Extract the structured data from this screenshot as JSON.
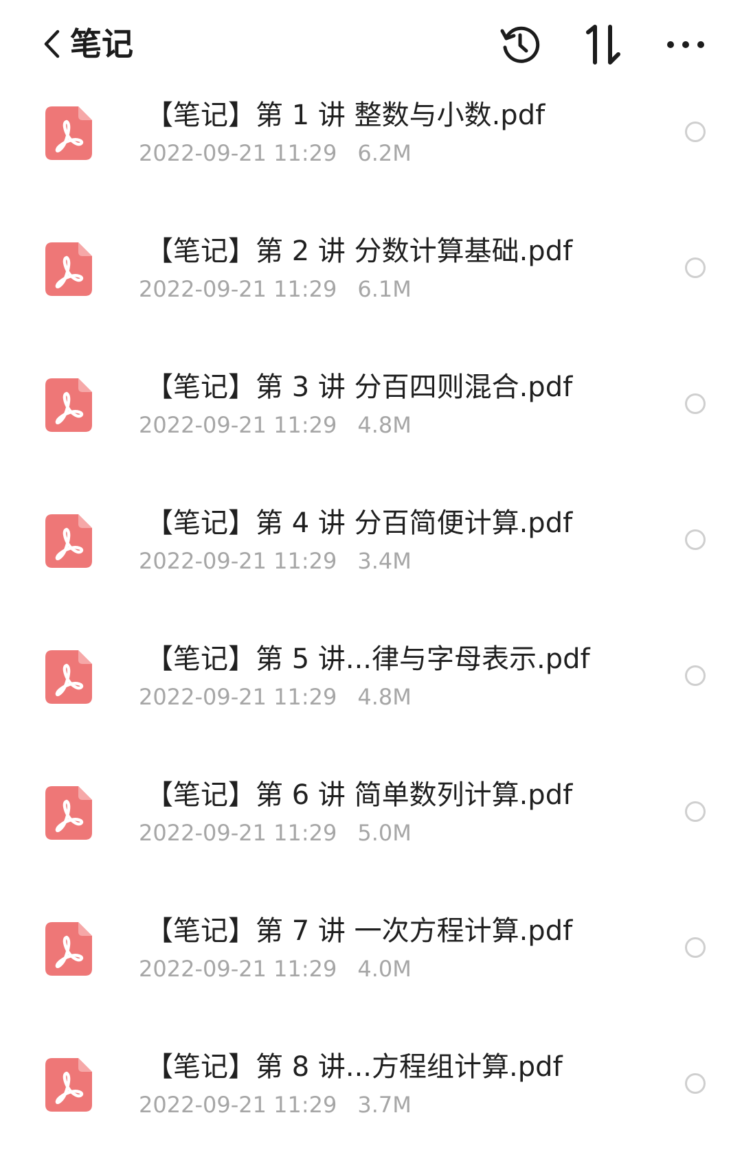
{
  "header": {
    "title": "笔记",
    "icons": {
      "back": "chevron-left-icon",
      "history": "history-icon",
      "sort": "sort-icon",
      "more": "more-horizontal-icon"
    }
  },
  "colors": {
    "pdf_icon": "#EE7777",
    "meta_text": "#A6A6A6",
    "radio_border": "#CFCFCF"
  },
  "files": [
    {
      "name": "【笔记】第 1 讲 整数与小数.pdf",
      "date": "2022-09-21 11:29",
      "size": "6.2M"
    },
    {
      "name": "【笔记】第 2 讲 分数计算基础.pdf",
      "date": "2022-09-21 11:29",
      "size": "6.1M"
    },
    {
      "name": "【笔记】第 3 讲 分百四则混合.pdf",
      "date": "2022-09-21 11:29",
      "size": "4.8M"
    },
    {
      "name": "【笔记】第 4 讲 分百简便计算.pdf",
      "date": "2022-09-21 11:29",
      "size": "3.4M"
    },
    {
      "name": "【笔记】第 5 讲...律与字母表示.pdf",
      "date": "2022-09-21 11:29",
      "size": "4.8M"
    },
    {
      "name": "【笔记】第 6 讲 简单数列计算.pdf",
      "date": "2022-09-21 11:29",
      "size": "5.0M"
    },
    {
      "name": "【笔记】第 7 讲 一次方程计算.pdf",
      "date": "2022-09-21 11:29",
      "size": "4.0M"
    },
    {
      "name": "【笔记】第 8 讲...方程组计算.pdf",
      "date": "2022-09-21 11:29",
      "size": "3.7M"
    }
  ]
}
